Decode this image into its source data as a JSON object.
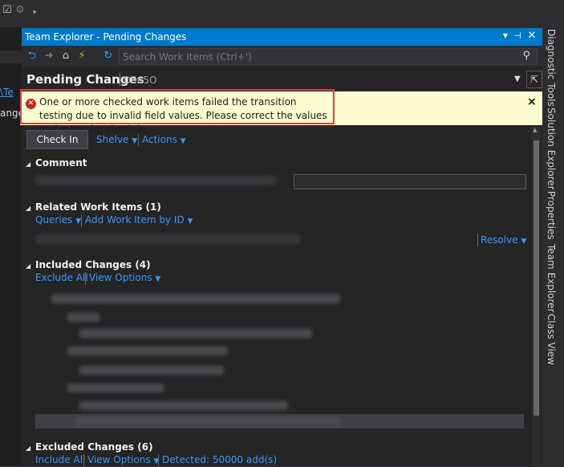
{
  "window": {
    "title": "Team Explorer - Pending Changes",
    "search_placeholder": "Search Work Items (Ctrl+')",
    "buttons": [
      "dropdown",
      "pin",
      "close"
    ]
  },
  "left_pane": {
    "fragments": [
      "\\Te",
      "ange"
    ]
  },
  "page": {
    "title": "Pending Changes",
    "project": "D365O"
  },
  "error": {
    "message": "One or more checked work items failed the transition testing due to invalid field values. Please correct the values and retry the check-in.",
    "icon": "error-icon",
    "close": "×"
  },
  "actions": {
    "checkin": "Check In",
    "shelve": "Shelve",
    "actions": "Actions"
  },
  "sections": {
    "comment": "Comment",
    "related": {
      "title": "Related Work Items (1)",
      "queries": "Queries",
      "add_by_id": "Add Work Item by ID",
      "resolve": "Resolve"
    },
    "included": {
      "title": "Included Changes (4)",
      "exclude_all": "Exclude All",
      "view_options": "View Options"
    },
    "excluded": {
      "title": "Excluded Changes (6)",
      "include_all": "Include All",
      "view_options": "View Options",
      "detected": "Detected: 50000 add(s)"
    }
  },
  "side_tabs": [
    "Diagnostic Tools",
    "Solution Explorer",
    "Properties",
    "Team Explorer",
    "Class View"
  ],
  "colors": {
    "accent": "#007acc",
    "link": "#3399ff",
    "banner_bg": "#fdfbd0",
    "banner_border": "#e0413b",
    "error": "#c42b1c"
  }
}
